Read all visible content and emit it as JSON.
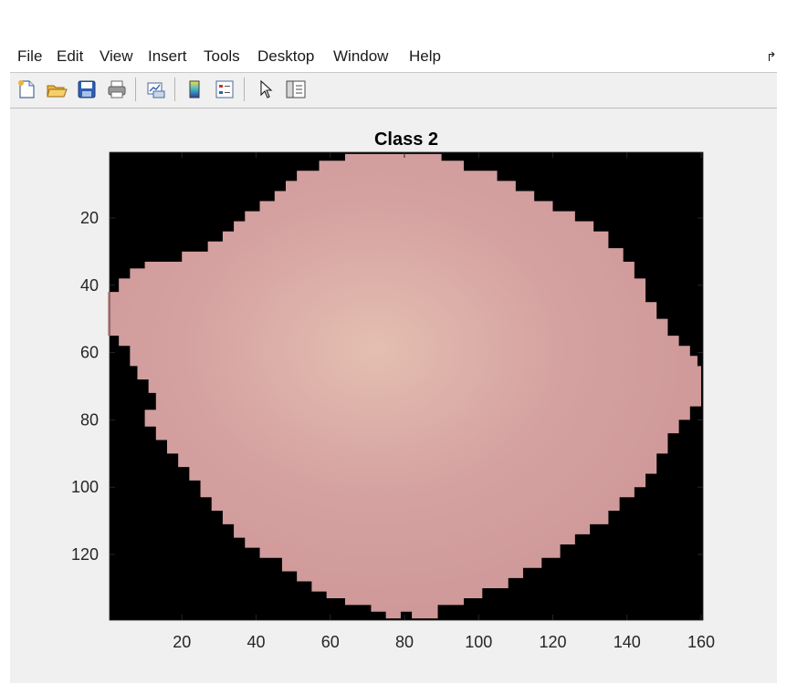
{
  "menu": {
    "items": [
      "File",
      "Edit",
      "View",
      "Insert",
      "Tools",
      "Desktop",
      "Window",
      "Help"
    ]
  },
  "toolbar": {
    "buttons": [
      {
        "icon": "new-file-icon"
      },
      {
        "icon": "open-folder-icon"
      },
      {
        "icon": "save-icon"
      },
      {
        "icon": "print-icon"
      },
      {
        "icon": "link-plot-icon"
      },
      {
        "icon": "colorbar-icon"
      },
      {
        "icon": "legend-icon"
      },
      {
        "icon": "pointer-icon"
      },
      {
        "icon": "property-inspector-icon"
      }
    ]
  },
  "colors": {
    "figure_bg": "#f0f0f0",
    "image_bg": "#000000",
    "cell_fill": "#d4a0a0",
    "cell_light": "#e4bfb0"
  },
  "chart_data": {
    "type": "image",
    "title": "Class 2",
    "xlim": [
      0.5,
      160.5
    ],
    "ylim": [
      0.5,
      139.5
    ],
    "y_reversed": true,
    "xticks": [
      20,
      40,
      60,
      80,
      100,
      120,
      140,
      160
    ],
    "yticks": [
      20,
      40,
      60,
      80,
      100,
      120
    ],
    "cell_outline": [
      [
        69,
        1
      ],
      [
        72,
        1
      ],
      [
        76,
        1
      ],
      [
        83,
        1
      ],
      [
        90,
        1
      ],
      [
        90,
        3
      ],
      [
        96,
        3
      ],
      [
        96,
        6
      ],
      [
        105,
        6
      ],
      [
        105,
        9
      ],
      [
        110,
        9
      ],
      [
        110,
        12
      ],
      [
        115,
        12
      ],
      [
        115,
        15
      ],
      [
        120,
        15
      ],
      [
        120,
        18
      ],
      [
        126,
        18
      ],
      [
        126,
        21
      ],
      [
        131,
        21
      ],
      [
        131,
        24
      ],
      [
        135,
        24
      ],
      [
        135,
        29
      ],
      [
        139,
        29
      ],
      [
        139,
        33
      ],
      [
        142,
        33
      ],
      [
        142,
        38
      ],
      [
        145,
        38
      ],
      [
        145,
        45
      ],
      [
        148,
        45
      ],
      [
        148,
        50
      ],
      [
        151,
        50
      ],
      [
        151,
        55
      ],
      [
        154,
        55
      ],
      [
        154,
        58
      ],
      [
        157,
        58
      ],
      [
        157,
        61
      ],
      [
        159,
        61
      ],
      [
        159,
        64
      ],
      [
        160,
        64
      ],
      [
        160,
        69
      ],
      [
        158,
        69
      ],
      [
        160,
        69
      ],
      [
        160,
        76
      ],
      [
        157,
        76
      ],
      [
        157,
        80
      ],
      [
        154,
        80
      ],
      [
        154,
        84
      ],
      [
        151,
        84
      ],
      [
        151,
        90
      ],
      [
        148,
        90
      ],
      [
        148,
        96
      ],
      [
        145,
        96
      ],
      [
        145,
        100
      ],
      [
        142,
        100
      ],
      [
        142,
        103
      ],
      [
        138,
        103
      ],
      [
        138,
        107
      ],
      [
        135,
        107
      ],
      [
        135,
        111
      ],
      [
        130,
        111
      ],
      [
        130,
        114
      ],
      [
        126,
        114
      ],
      [
        126,
        117
      ],
      [
        122,
        117
      ],
      [
        122,
        121
      ],
      [
        117,
        121
      ],
      [
        117,
        124
      ],
      [
        112,
        124
      ],
      [
        112,
        127
      ],
      [
        108,
        127
      ],
      [
        108,
        130
      ],
      [
        101,
        130
      ],
      [
        101,
        133
      ],
      [
        96,
        133
      ],
      [
        96,
        135
      ],
      [
        89,
        135
      ],
      [
        89,
        139
      ],
      [
        82,
        139
      ],
      [
        82,
        137
      ],
      [
        79,
        137
      ],
      [
        79,
        139
      ],
      [
        75,
        139
      ],
      [
        75,
        137
      ],
      [
        71,
        137
      ],
      [
        71,
        135
      ],
      [
        64,
        135
      ],
      [
        64,
        133
      ],
      [
        59,
        133
      ],
      [
        59,
        131
      ],
      [
        55,
        131
      ],
      [
        55,
        128
      ],
      [
        51,
        128
      ],
      [
        51,
        125
      ],
      [
        47,
        125
      ],
      [
        47,
        121
      ],
      [
        41,
        121
      ],
      [
        41,
        118
      ],
      [
        37,
        118
      ],
      [
        37,
        115
      ],
      [
        34,
        115
      ],
      [
        34,
        111
      ],
      [
        31,
        111
      ],
      [
        31,
        107
      ],
      [
        28,
        107
      ],
      [
        28,
        103
      ],
      [
        25,
        103
      ],
      [
        25,
        98
      ],
      [
        22,
        98
      ],
      [
        22,
        94
      ],
      [
        19,
        94
      ],
      [
        19,
        90
      ],
      [
        16,
        90
      ],
      [
        16,
        86
      ],
      [
        13,
        86
      ],
      [
        13,
        82
      ],
      [
        10,
        82
      ],
      [
        10,
        77
      ],
      [
        13,
        77
      ],
      [
        13,
        72
      ],
      [
        11,
        72
      ],
      [
        11,
        68
      ],
      [
        8,
        68
      ],
      [
        8,
        64
      ],
      [
        6,
        64
      ],
      [
        6,
        58
      ],
      [
        3,
        58
      ],
      [
        3,
        55
      ],
      [
        0,
        55
      ],
      [
        0,
        42
      ],
      [
        3,
        42
      ],
      [
        3,
        38
      ],
      [
        6,
        38
      ],
      [
        6,
        35
      ],
      [
        10,
        35
      ],
      [
        10,
        33
      ],
      [
        20,
        33
      ],
      [
        20,
        30
      ],
      [
        27,
        30
      ],
      [
        27,
        27
      ],
      [
        31,
        27
      ],
      [
        31,
        24
      ],
      [
        34,
        24
      ],
      [
        34,
        21
      ],
      [
        37,
        21
      ],
      [
        37,
        18
      ],
      [
        41,
        18
      ],
      [
        41,
        15
      ],
      [
        45,
        15
      ],
      [
        45,
        12
      ],
      [
        48,
        12
      ],
      [
        48,
        9
      ],
      [
        51,
        9
      ],
      [
        51,
        6
      ],
      [
        57,
        6
      ],
      [
        57,
        3
      ],
      [
        64,
        3
      ],
      [
        64,
        1
      ],
      [
        69,
        1
      ]
    ]
  }
}
